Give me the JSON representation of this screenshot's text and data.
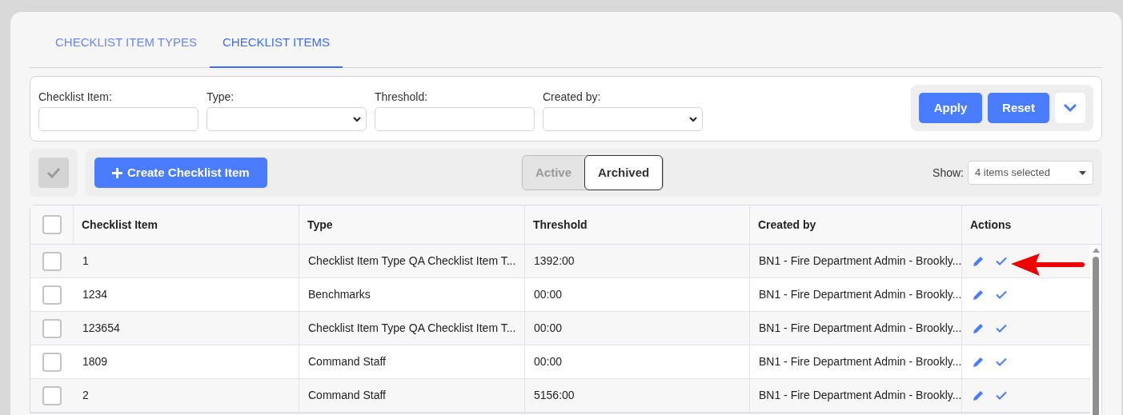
{
  "tabs": [
    {
      "label": "CHECKLIST ITEM TYPES",
      "selected": false
    },
    {
      "label": "CHECKLIST ITEMS",
      "selected": true
    }
  ],
  "filters": [
    {
      "label": "Checklist Item:",
      "kind": "text"
    },
    {
      "label": "Type:",
      "kind": "select"
    },
    {
      "label": "Threshold:",
      "kind": "text"
    },
    {
      "label": "Created by:",
      "kind": "select"
    }
  ],
  "filter_buttons": [
    "Apply",
    "Reset"
  ],
  "toolbar": {
    "select_all_checked": false,
    "create_button": "Create Checklist Item",
    "status_toggle": [
      {
        "label": "Active",
        "selected": false
      },
      {
        "label": "Archived",
        "selected": true
      }
    ],
    "show_label": "Show:",
    "show_value": "4 items selected"
  },
  "table": {
    "header_checked": false,
    "columns": [
      "Checklist Item",
      "Type",
      "Threshold",
      "Created by",
      "Actions"
    ],
    "rows": [
      {
        "checked": false,
        "cells": [
          "1",
          "Checklist Item Type QA Checklist Item T...",
          "1392:00",
          "BN1 - Fire Department Admin - Brookly..."
        ]
      },
      {
        "checked": false,
        "cells": [
          "1234",
          "Benchmarks",
          "00:00",
          "BN1 - Fire Department Admin - Brookly..."
        ]
      },
      {
        "checked": false,
        "cells": [
          "123654",
          "Checklist Item Type QA Checklist Item T...",
          "00:00",
          "BN1 - Fire Department Admin - Brookly..."
        ]
      },
      {
        "checked": false,
        "cells": [
          "1809",
          "Command Staff",
          "00:00",
          "BN1 - Fire Department Admin - Brookly..."
        ]
      },
      {
        "checked": false,
        "cells": [
          "2",
          "Command Staff",
          "5156:00",
          "BN1 - Fire Department Admin - Brookly..."
        ]
      }
    ]
  }
}
